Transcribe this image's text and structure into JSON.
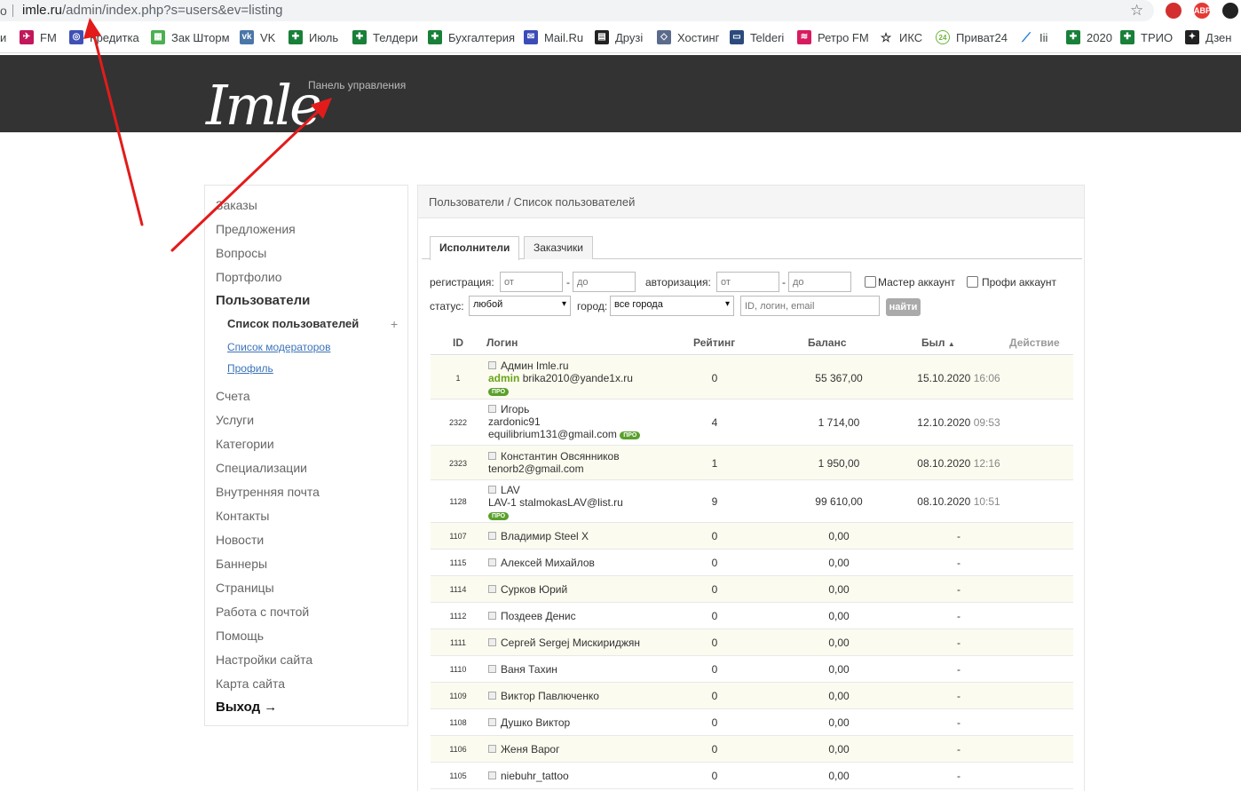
{
  "browser": {
    "address_lead": "o",
    "url_host": "imle.ru",
    "url_rest": "/admin/index.php?s=users&ev=listing",
    "extensions": [
      "",
      "ABP",
      ""
    ],
    "bookmarks": [
      {
        "label": "и",
        "icon": "partial-icon",
        "color": "#999999"
      },
      {
        "label": "FM",
        "icon": "bird-icon",
        "color": "#c2185b"
      },
      {
        "label": "Кредитка",
        "icon": "target-icon",
        "color": "#3f51b5"
      },
      {
        "label": "Зак Шторм",
        "icon": "creeper-icon",
        "color": "#4caf50"
      },
      {
        "label": "VK",
        "icon": "vk-icon",
        "color": "#4a76a8"
      },
      {
        "label": "Июль",
        "icon": "sheet-icon",
        "color": "#188038"
      },
      {
        "label": "Телдери",
        "icon": "sheet-icon",
        "color": "#188038"
      },
      {
        "label": "Бухгалтерия",
        "icon": "sheet-icon",
        "color": "#188038"
      },
      {
        "label": "Mail.Ru",
        "icon": "mail-icon",
        "color": "#3b4cb8"
      },
      {
        "label": "Друзі",
        "icon": "clapper-icon",
        "color": "#222222"
      },
      {
        "label": "Хостинг",
        "icon": "puzzle-icon",
        "color": "#5b6b8c"
      },
      {
        "label": "Telderi",
        "icon": "monitor-icon",
        "color": "#2c4a7c"
      },
      {
        "label": "Ретро FM",
        "icon": "radio-icon",
        "color": "#d81b60"
      },
      {
        "label": "ИКС",
        "icon": "star-outline-icon",
        "color": "#222222"
      },
      {
        "label": "Приват24",
        "icon": "privat-icon",
        "color": "#6bb43a"
      },
      {
        "label": "Iii",
        "icon": "chart-line-icon",
        "color": "#1976d2"
      },
      {
        "label": "2020",
        "icon": "sheet-icon",
        "color": "#188038"
      },
      {
        "label": "ТРИО",
        "icon": "sheet-icon",
        "color": "#188038"
      },
      {
        "label": "Дзен",
        "icon": "zen-icon",
        "color": "#222222"
      }
    ]
  },
  "header": {
    "logo": "Imle",
    "panel_title": "Панель управления"
  },
  "sidebar": {
    "items": [
      {
        "label": "Заказы",
        "state": "normal"
      },
      {
        "label": "Предложения",
        "state": "normal"
      },
      {
        "label": "Вопросы",
        "state": "normal"
      },
      {
        "label": "Портфолио",
        "state": "normal"
      },
      {
        "label": "Пользователи",
        "state": "active"
      }
    ],
    "subitems": [
      {
        "label": "Список пользователей",
        "state": "active"
      },
      {
        "label": "Список модераторов",
        "state": "link"
      },
      {
        "label": "Профиль",
        "state": "link"
      }
    ],
    "plus": "+",
    "items_after": [
      "Счета",
      "Услуги",
      "Категории",
      "Специализации",
      "Внутренняя почта",
      "Контакты",
      "Новости",
      "Баннеры",
      "Страницы",
      "Работа с почтой",
      "Помощь",
      "Настройки сайта",
      "Карта сайта"
    ],
    "logout": "Выход →"
  },
  "content": {
    "breadcrumb": "Пользователи / Список пользователей",
    "tabs": [
      {
        "label": "Исполнители",
        "active": true
      },
      {
        "label": "Заказчики",
        "active": false
      }
    ],
    "filters": {
      "registration_label": "регистрация:",
      "reg_from_placeholder": "от",
      "reg_to_placeholder": "до",
      "dash": "-",
      "authorization_label": "авторизация:",
      "auth_from_placeholder": "от",
      "auth_to_placeholder": "до",
      "master_account": "Мастер аккаунт",
      "profi_account": "Профи аккаунт",
      "status_label": "статус:",
      "status_value": "любой",
      "city_label": "город:",
      "city_value": "все города",
      "search_placeholder": "ID, логин, email",
      "find_button": "найти"
    },
    "table": {
      "columns": {
        "id": "ID",
        "login": "Логин",
        "rating": "Рейтинг",
        "balance": "Баланс",
        "seen": "Был",
        "action": "Действие"
      },
      "sort_indicator": "▲",
      "rows": [
        {
          "id": "1",
          "name": "Админ Imle.ru",
          "login": "admin",
          "email": "brika2010@yande1x.ru",
          "pro": "ПРО",
          "layout": "admin",
          "rating": "0",
          "balance": "55 367,00",
          "date": "15.10.2020",
          "time": "16:06"
        },
        {
          "id": "2322",
          "name": "Игорь",
          "login": "zardonic91",
          "email": "equilibrium131@gmail.com",
          "pro": "ПРО",
          "layout": "three-line",
          "rating": "4",
          "balance": "1 714,00",
          "date": "12.10.2020",
          "time": "09:53"
        },
        {
          "id": "2323",
          "name": "Константин Овсянников",
          "login": "",
          "email": "tenorb2@gmail.com",
          "pro": "",
          "layout": "two-line",
          "rating": "1",
          "balance": "1 950,00",
          "date": "08.10.2020",
          "time": "12:16"
        },
        {
          "id": "1128",
          "name": "LAV",
          "login": "LAV-1",
          "email": "stalmokasLAV@list.ru",
          "pro": "ПРО",
          "layout": "badge-below",
          "rating": "9",
          "balance": "99 610,00",
          "date": "08.10.2020",
          "time": "10:51"
        },
        {
          "id": "1107",
          "name": "Владимир Steel X",
          "rating": "0",
          "balance": "0,00",
          "date": "-",
          "time": "",
          "layout": "single"
        },
        {
          "id": "1115",
          "name": "Алексей Михайлов",
          "rating": "0",
          "balance": "0,00",
          "date": "-",
          "time": "",
          "layout": "single"
        },
        {
          "id": "1114",
          "name": "Сурков Юрий",
          "rating": "0",
          "balance": "0,00",
          "date": "-",
          "time": "",
          "layout": "single"
        },
        {
          "id": "1112",
          "name": "Поздеев Денис",
          "rating": "0",
          "balance": "0,00",
          "date": "-",
          "time": "",
          "layout": "single"
        },
        {
          "id": "1111",
          "name": "Сергей Sergej Мискириджян",
          "rating": "0",
          "balance": "0,00",
          "date": "-",
          "time": "",
          "layout": "single"
        },
        {
          "id": "1110",
          "name": "Ваня Тахин",
          "rating": "0",
          "balance": "0,00",
          "date": "-",
          "time": "",
          "layout": "single"
        },
        {
          "id": "1109",
          "name": "Виктор Павлюченко",
          "rating": "0",
          "balance": "0,00",
          "date": "-",
          "time": "",
          "layout": "single"
        },
        {
          "id": "1108",
          "name": "Душко Виктор",
          "rating": "0",
          "balance": "0,00",
          "date": "-",
          "time": "",
          "layout": "single"
        },
        {
          "id": "1106",
          "name": "Женя Варог",
          "rating": "0",
          "balance": "0,00",
          "date": "-",
          "time": "",
          "layout": "single"
        },
        {
          "id": "1105",
          "name": "niebuhr_tattoo",
          "rating": "0",
          "balance": "0,00",
          "date": "-",
          "time": "",
          "layout": "single"
        }
      ]
    }
  },
  "colors": {
    "header_bg": "#333333",
    "row_alt": "#fbfbef",
    "pro_badge": "#5aa02c",
    "admin_login": "#6aa31a",
    "link": "#3b73b9",
    "annotation_arrow": "#e31b1b"
  }
}
